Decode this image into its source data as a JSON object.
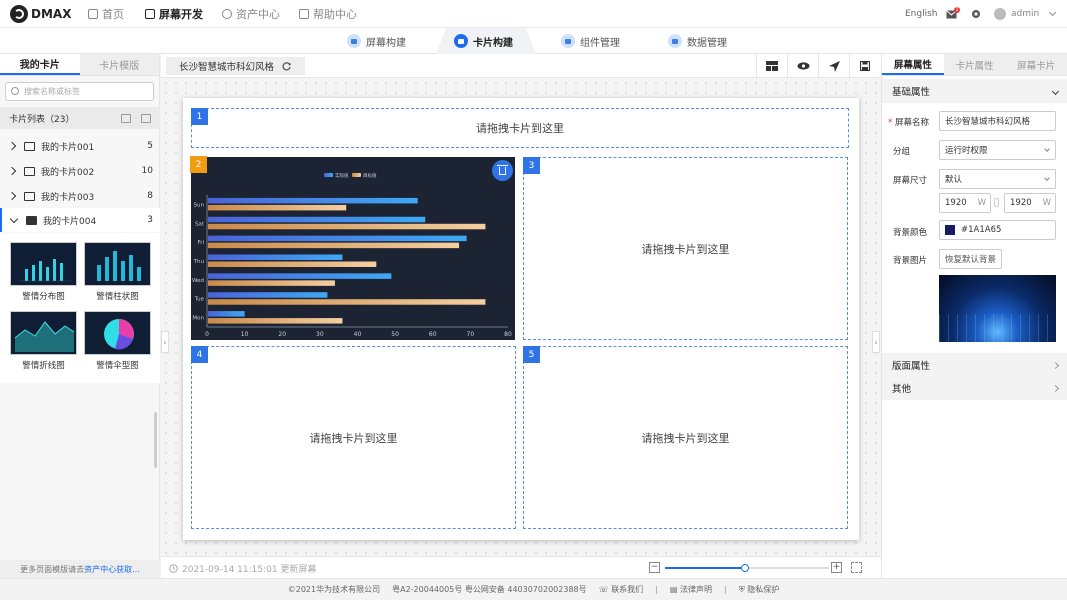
{
  "app": {
    "brand": "DMAX"
  },
  "topnav": [
    {
      "label": "首页",
      "icon": "home-icon"
    },
    {
      "label": "屏幕开发",
      "icon": "monitor-icon",
      "active": true
    },
    {
      "label": "资产中心",
      "icon": "gear-icon"
    },
    {
      "label": "帮助中心",
      "icon": "help-icon"
    }
  ],
  "topright": {
    "lang": "English",
    "mail_badge": "1",
    "user": "admin"
  },
  "subtabs": [
    {
      "label": "屏幕构建"
    },
    {
      "label": "卡片构建",
      "active": true
    },
    {
      "label": "组件管理"
    },
    {
      "label": "数据管理"
    }
  ],
  "left": {
    "tabs": [
      "我的卡片",
      "卡片模版"
    ],
    "search_placeholder": "搜索名称或标签",
    "list_title": "卡片列表（23）",
    "folders": [
      {
        "name": "我的卡片001",
        "count": "5"
      },
      {
        "name": "我的卡片002",
        "count": "10"
      },
      {
        "name": "我的卡片003",
        "count": "8"
      },
      {
        "name": "我的卡片004",
        "count": "3"
      }
    ],
    "cards": [
      {
        "label": "警情分布图",
        "icon": "bar-chart-thumb"
      },
      {
        "label": "警情柱状图",
        "icon": "column-chart-thumb"
      },
      {
        "label": "警情折线图",
        "icon": "area-chart-thumb"
      },
      {
        "label": "警情伞型图",
        "icon": "pie-chart-thumb"
      }
    ],
    "footer_text": "更多页面模版请去",
    "footer_link": "资产中心获取..."
  },
  "center": {
    "screen_name": "长沙智慧城市科幻风格",
    "placeholder": "请拖拽卡片到这里",
    "slots": [
      "1",
      "2",
      "3",
      "4",
      "5"
    ],
    "updated": "2021-09-14 11:15:01 更新屏幕",
    "zoom_fraction": 0.49,
    "chart_data": {
      "type": "bar",
      "orientation": "horizontal",
      "categories": [
        "Sun",
        "Sat",
        "Fri",
        "Thu",
        "Wed",
        "Tue",
        "Mon"
      ],
      "series": [
        {
          "name": "实际值",
          "values": [
            56,
            58,
            69,
            36,
            49,
            32,
            10
          ],
          "color": "#3fa9f5"
        },
        {
          "name": "目标值",
          "values": [
            37,
            74,
            67,
            45,
            34,
            74,
            36
          ],
          "color": "#f5cfa0"
        }
      ],
      "xlim": [
        0,
        80
      ],
      "xticks": [
        0,
        10,
        20,
        30,
        40,
        50,
        60,
        70,
        80
      ],
      "legend": "top-center",
      "background": "#1c2433"
    }
  },
  "right": {
    "tabs": [
      "屏幕属性",
      "卡片属性",
      "屏幕卡片"
    ],
    "basic_title": "基础属性",
    "name_label": "屏幕名称",
    "name_value": "长沙智慧城市科幻风格",
    "group_label": "分组",
    "group_value": "运行时权限",
    "size_label": "屏幕尺寸",
    "size_value": "默认",
    "width": "1920",
    "height": "1920",
    "unit": "W",
    "bgcolor_label": "背景颜色",
    "bgcolor_value": "#1A1A65",
    "bgimg_label": "背景图片",
    "restore_btn": "恢复默认背景",
    "layout_title": "版面属性",
    "other_title": "其他"
  },
  "footer": {
    "copyright": "©2021华为技术有限公司",
    "icp": "粤A2-20044005号 粤公网安备 44030702002388号",
    "contact": "联系我们",
    "legal": "法律声明",
    "privacy": "隐私保护"
  }
}
